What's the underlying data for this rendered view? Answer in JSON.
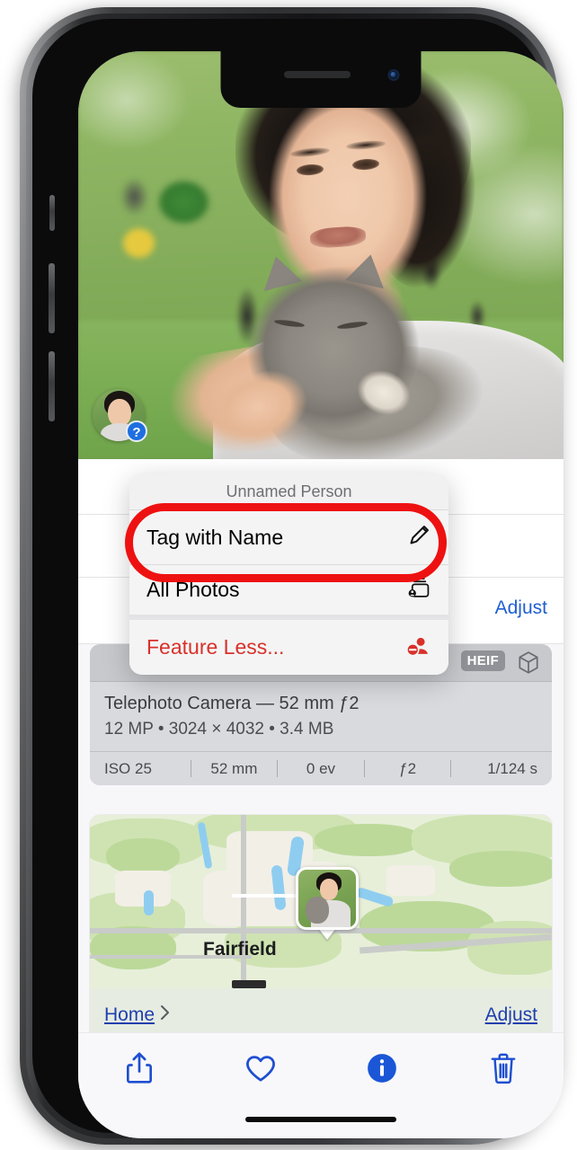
{
  "app": {
    "name": "Photos",
    "device": "iPhone"
  },
  "photo": {
    "alt_description": "Person holding a grey cat outdoors in a green garden",
    "face_chip": {
      "badge": "?",
      "name": "face-thumbnail"
    }
  },
  "context_menu": {
    "title": "Unnamed Person",
    "items": [
      {
        "label": "Tag with Name",
        "icon": "pencil-icon",
        "destructive": false
      },
      {
        "label": "All Photos",
        "icon": "person-stack-icon",
        "destructive": false
      },
      {
        "label": "Feature Less...",
        "icon": "person-minus-icon",
        "destructive": true
      }
    ]
  },
  "annotation": {
    "shape": "oval",
    "color": "#ee1111",
    "target": "Tag with Name"
  },
  "info_sheet": {
    "adjust_label": "Adjust",
    "exif": {
      "format_badge": "HEIF",
      "depth_icon": "cube-icon",
      "camera_line": "Telephoto Camera — 52 mm ƒ2",
      "details_line": "12 MP  •  3024 × 4032  •  3.4 MB",
      "stats": [
        "ISO 25",
        "52 mm",
        "0 ev",
        "ƒ2",
        "1/124 s"
      ]
    },
    "map": {
      "place_label": "Fairfield",
      "home_label": "Home",
      "chevron": "chevron-right-icon",
      "adjust_label": "Adjust"
    }
  },
  "toolbar": {
    "buttons": [
      {
        "name": "share-button",
        "icon": "share-icon",
        "active": false
      },
      {
        "name": "favorite-button",
        "icon": "heart-icon",
        "active": false
      },
      {
        "name": "info-button",
        "icon": "info-icon",
        "active": true
      },
      {
        "name": "delete-button",
        "icon": "trash-icon",
        "active": false
      }
    ],
    "accent_color": "#1f4fd0",
    "active_color": "#1a56d6"
  }
}
